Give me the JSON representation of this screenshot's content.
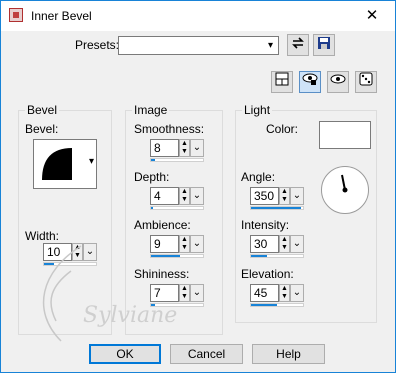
{
  "window": {
    "title": "Inner Bevel",
    "close_glyph": "✕"
  },
  "presets": {
    "label": "Presets:",
    "value": "",
    "arrow": "▾"
  },
  "groups": {
    "bevel": "Bevel",
    "image": "Image",
    "light": "Light"
  },
  "bevel": {
    "label": "Bevel:",
    "width_label": "Width:",
    "width_value": "10",
    "width_fraction": 0.2
  },
  "image": {
    "smoothness": {
      "label": "Smoothness:",
      "value": "8",
      "fraction": 0.08
    },
    "depth": {
      "label": "Depth:",
      "value": "4",
      "fraction": 0.04
    },
    "ambience": {
      "label": "Ambience:",
      "value": "9",
      "fraction": 0.55
    },
    "shininess": {
      "label": "Shininess:",
      "value": "7",
      "fraction": 0.07
    }
  },
  "light": {
    "color_label": "Color:",
    "color_value": "#ffffff",
    "angle": {
      "label": "Angle:",
      "value": "350",
      "fraction": 0.97
    },
    "intensity": {
      "label": "Intensity:",
      "value": "30",
      "fraction": 0.3
    },
    "elevation": {
      "label": "Elevation:",
      "value": "45",
      "fraction": 0.5
    }
  },
  "buttons": {
    "ok": "OK",
    "cancel": "Cancel",
    "help": "Help"
  },
  "watermark": {
    "text": "Sylviane"
  },
  "colors": {
    "accent": "#1883d7",
    "window_bg": "#f0f0f0"
  }
}
